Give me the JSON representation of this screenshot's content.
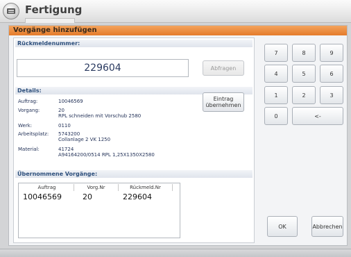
{
  "window": {
    "title": "Fertigung"
  },
  "dialog": {
    "title": "Vorgänge hinzufügen"
  },
  "rueckmeldenummer": {
    "section_title": "Rückmeldenummer:",
    "value": "229604",
    "query_button": "Abfragen"
  },
  "details": {
    "section_title": "Details:",
    "take_button_line1": "Eintrag",
    "take_button_line2": "übernehmen",
    "rows": [
      {
        "label": "Auftrag:",
        "value": "10046569",
        "sub": ""
      },
      {
        "label": "Vorgang:",
        "value": "20",
        "sub": "RPL schneiden mit Vorschub 2580"
      },
      {
        "label": "Werk:",
        "value": "0110",
        "sub": ""
      },
      {
        "label": "Arbeitsplatz:",
        "value": "5743200",
        "sub": "Collanlage 2 VK 1250"
      },
      {
        "label": "Material:",
        "value": "41724",
        "sub": "A94164200/0514  RPL 1,25X1350X2580"
      }
    ]
  },
  "uebernommen": {
    "section_title": "Übernommene Vorgänge:",
    "columns": [
      "Auftrag",
      "Vorg.Nr",
      "Rückmeld.Nr"
    ],
    "rows": [
      {
        "auftrag": "10046569",
        "vorgnr": "20",
        "rueckmeldnr": "229604"
      }
    ]
  },
  "keypad": {
    "keys": [
      "7",
      "8",
      "9",
      "4",
      "5",
      "6",
      "1",
      "2",
      "3",
      "0",
      "<-"
    ]
  },
  "footer": {
    "ok": "OK",
    "cancel": "Abbrechen"
  },
  "colors": {
    "header_orange": "#e47b2a",
    "section_blue": "#2d4f7c"
  }
}
